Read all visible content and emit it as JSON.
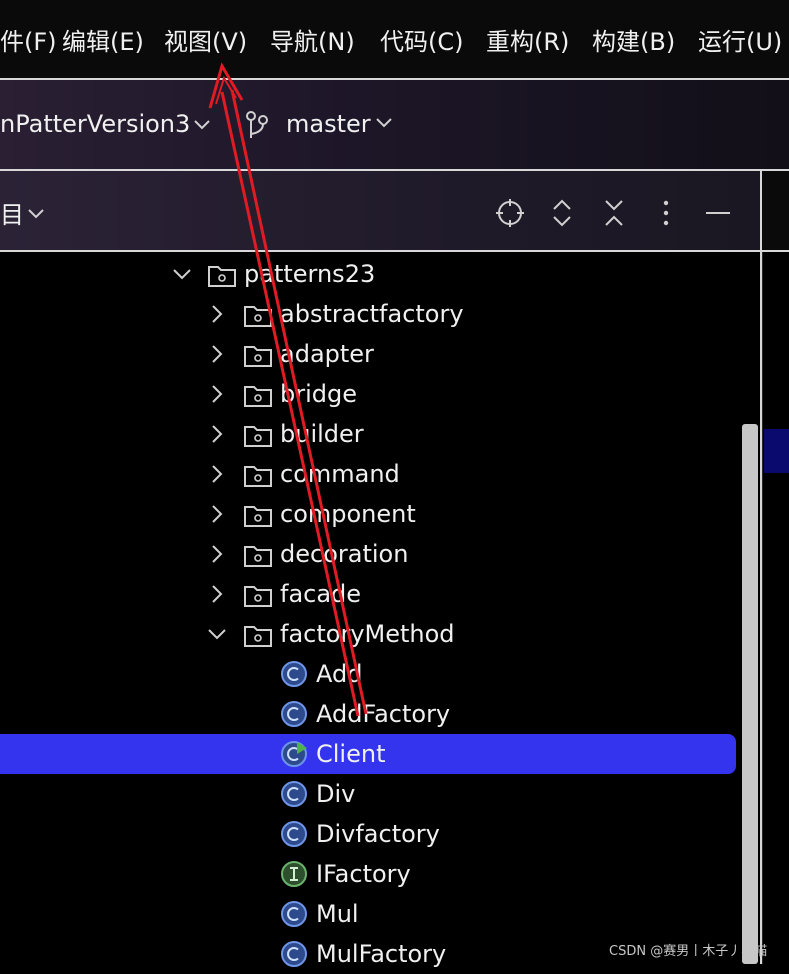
{
  "menu": {
    "items": [
      {
        "label": "件(F)"
      },
      {
        "label": "编辑(E)"
      },
      {
        "label": "视图(V)"
      },
      {
        "label": "导航(N)"
      },
      {
        "label": "代码(C)"
      },
      {
        "label": "重构(R)"
      },
      {
        "label": "构建(B)"
      },
      {
        "label": "运行(U)"
      }
    ]
  },
  "toolbar": {
    "project": "nPatterVersion3",
    "branch": "master"
  },
  "project_panel": {
    "title": "目"
  },
  "tree": {
    "root": {
      "label": "patterns23",
      "expanded": true
    },
    "packages": [
      {
        "label": "abstractfactory",
        "expanded": false
      },
      {
        "label": "adapter",
        "expanded": false
      },
      {
        "label": "bridge",
        "expanded": false
      },
      {
        "label": "builder",
        "expanded": false
      },
      {
        "label": "command",
        "expanded": false
      },
      {
        "label": "component",
        "expanded": false
      },
      {
        "label": "decoration",
        "expanded": false
      },
      {
        "label": "facade",
        "expanded": false
      },
      {
        "label": "factoryMethod",
        "expanded": true
      }
    ],
    "classes": [
      {
        "label": "Add",
        "kind": "class"
      },
      {
        "label": "AddFactory",
        "kind": "class"
      },
      {
        "label": "Client",
        "kind": "runnable-class",
        "selected": true
      },
      {
        "label": "Div",
        "kind": "class"
      },
      {
        "label": "Divfactory",
        "kind": "class"
      },
      {
        "label": "IFactory",
        "kind": "interface"
      },
      {
        "label": "Mul",
        "kind": "class"
      },
      {
        "label": "MulFactory",
        "kind": "class"
      }
    ]
  },
  "watermark": "CSDN @赛男丨木子丿小喵",
  "colors": {
    "selection": "#3434ee",
    "class_icon": "#4f7bd9",
    "interface_icon": "#5a9a58",
    "annotation_arrow": "#e01b24"
  }
}
